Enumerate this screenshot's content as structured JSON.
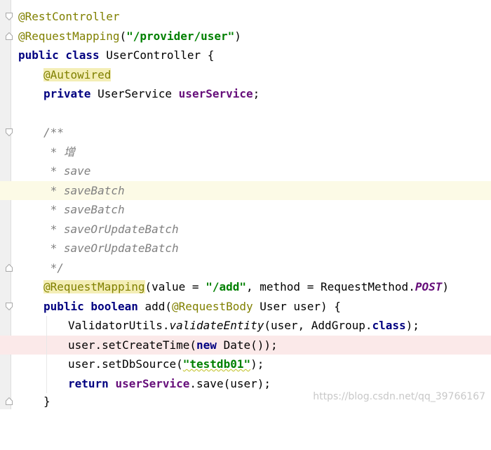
{
  "editor": {
    "lines": {
      "l1": {
        "ann": "@RestController"
      },
      "l2": {
        "ann": "@RequestMapping",
        "open": "(",
        "str": "\"/provider/user\"",
        "close": ")"
      },
      "l3": {
        "kw": "public class",
        "rest": " UserController {"
      },
      "l4": {
        "ann": "@Autowired"
      },
      "l5": {
        "kw": "private",
        "type": " UserService ",
        "field": "userService",
        "semi": ";"
      },
      "l6": {
        "text": ""
      },
      "l7": {
        "doc": "/**"
      },
      "l8": {
        "doc": " * 增"
      },
      "l9": {
        "doc": " * save"
      },
      "l10": {
        "doc": " * saveBatch"
      },
      "l11": {
        "doc": " * saveBatch"
      },
      "l12": {
        "doc": " * saveOrUpdateBatch"
      },
      "l13": {
        "doc": " * saveOrUpdateBatch"
      },
      "l14": {
        "doc": " */"
      },
      "l15": {
        "ann": "@RequestMapping",
        "a": "(value = ",
        "str": "\"/add\"",
        "b": ", method = RequestMethod.",
        "static": "POST",
        "c": ")"
      },
      "l16": {
        "kw1": "public boolean",
        "a": " add(",
        "ann": "@RequestBody",
        "b": " User user) {"
      },
      "l17": {
        "a": "ValidatorUtils.",
        "italic": "validateEntity",
        "b": "(user, AddGroup.",
        "kw": "class",
        "c": ");"
      },
      "l18": {
        "a": "user.setCreateTime(",
        "kw": "new",
        "b": " Date());"
      },
      "l19": {
        "a": "user.setDbSource(",
        "str": "\"testdb01\"",
        "b": ");"
      },
      "l20": {
        "kw": "return",
        "sp": " ",
        "field": "userService",
        "b": ".save(user);"
      },
      "l21": {
        "text": "}"
      }
    }
  },
  "watermark": "https://blog.csdn.net/qq_39766167"
}
